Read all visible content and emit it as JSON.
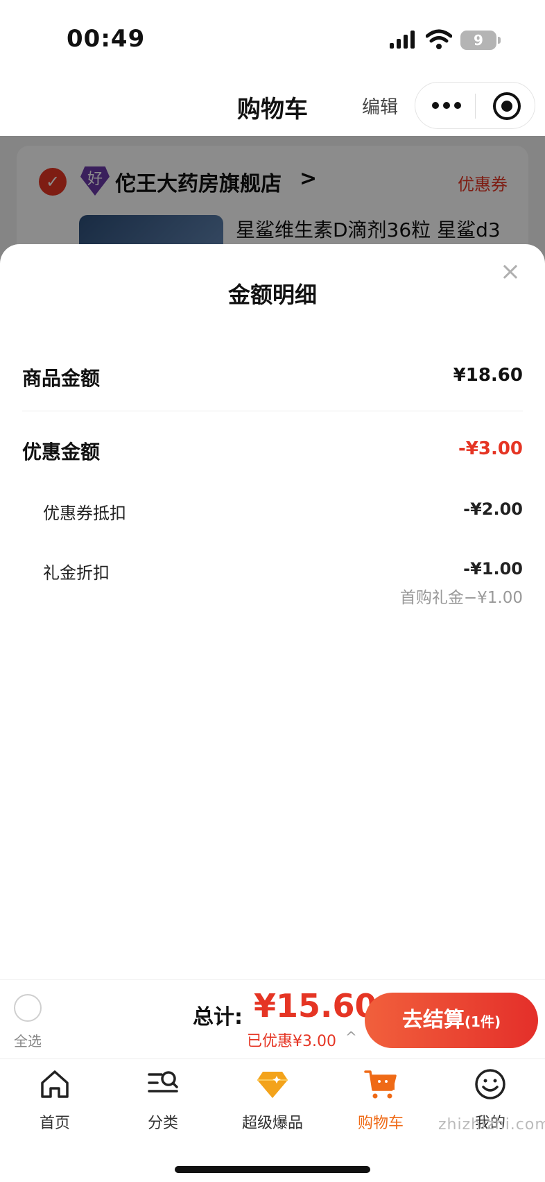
{
  "status_bar": {
    "time": "00:49",
    "battery": "9"
  },
  "nav": {
    "title": "购物车",
    "edit": "编辑"
  },
  "store": {
    "name": "佗王大药房旗舰店",
    "badge": "好",
    "arrow": ">",
    "coupon": "优惠券",
    "product_title": "星鲨维生素D滴剂36粒 星鲨d3"
  },
  "sheet": {
    "title": "金额明细",
    "close": "×",
    "goods_amount_label": "商品金额",
    "goods_amount_value": "¥18.60",
    "discount_label": "优惠金额",
    "discount_value": "-¥3.00",
    "coupon_label": "优惠券抵扣",
    "coupon_value": "-¥2.00",
    "gift_label": "礼金折扣",
    "gift_value": "-¥1.00",
    "gift_note": "首购礼金−¥1.00"
  },
  "checkout": {
    "select_all": "全选",
    "total_label": "总计:",
    "total_amount": "¥15.60",
    "discount_text": "已优惠¥3.00",
    "caret": "^",
    "button": "去结算",
    "button_count": "(1件)"
  },
  "tabs": [
    {
      "label": "首页",
      "icon": "home-icon"
    },
    {
      "label": "分类",
      "icon": "category-search-icon"
    },
    {
      "label": "超级爆品",
      "icon": "diamond-icon"
    },
    {
      "label": "购物车",
      "icon": "cart-icon",
      "active": true
    },
    {
      "label": "我的",
      "icon": "smiley-face-icon"
    }
  ],
  "watermark": "zhizhizhi.com",
  "colors": {
    "accent": "#e53524",
    "tab_active": "#ef6a16",
    "diamond": "#f3a31b"
  }
}
